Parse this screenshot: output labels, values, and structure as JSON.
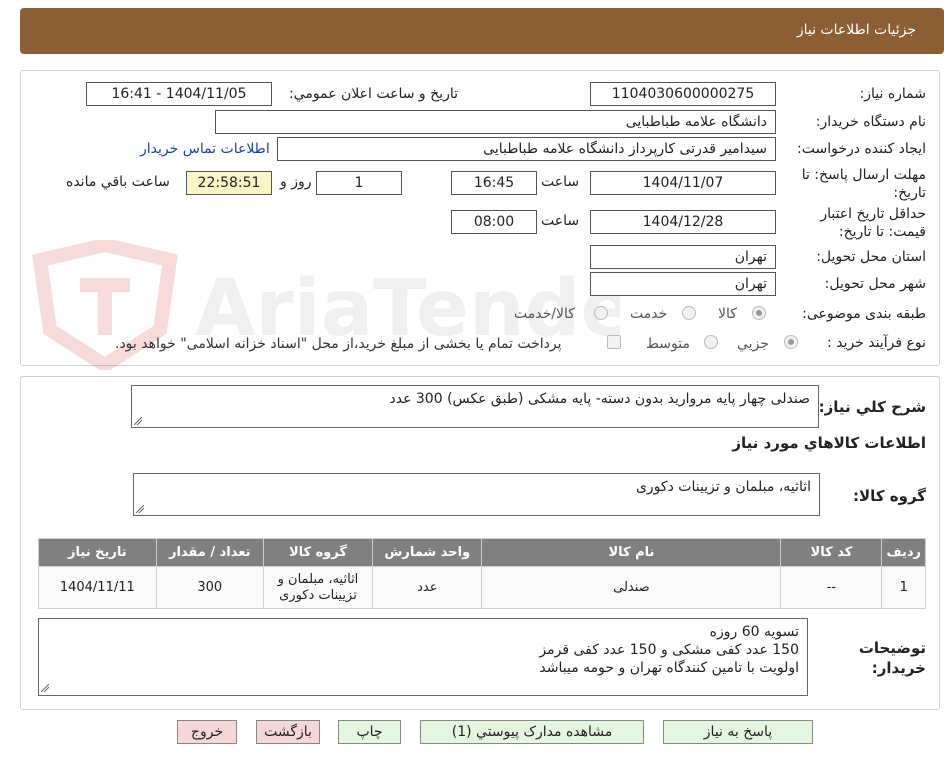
{
  "header": {
    "title": "جزئیات اطلاعات نیاز"
  },
  "form": {
    "need_number_label": "شماره نیاز:",
    "need_number": "1104030600000275",
    "announce_label": "تاریخ و ساعت اعلان عمومي:",
    "announce_value": "1404/11/05 - 16:41",
    "buyer_org_label": "نام دستگاه خریدار:",
    "buyer_org": "دانشگاه علامه طباطبایی",
    "requester_label": "ایجاد کننده درخواست:",
    "requester": "سیدامیر قدرتی کارپرداز دانشگاه علامه طباطبایی",
    "contact_link": "اطلاعات تماس خریدار",
    "deadline_label": "مهلت ارسال پاسخ: تا تاریخ:",
    "deadline_date": "1404/11/07",
    "time_label": "ساعت",
    "deadline_time": "16:45",
    "days_value": "1",
    "days_label": "روز و",
    "remaining_time": "22:58:51",
    "remaining_label": "ساعت باقي مانده",
    "validity_label": "حداقل تاریخ اعتبار قیمت: تا تاریخ:",
    "validity_date": "1404/12/28",
    "validity_time": "08:00",
    "province_label": "استان محل تحویل:",
    "province": "تهران",
    "city_label": "شهر محل تحویل:",
    "city": "تهران",
    "category_label": "طبقه بندی موضوعی:",
    "category_options": [
      "کالا",
      "خدمت",
      "کالا/خدمت"
    ],
    "process_label": "نوع فرآیند خرید :",
    "process_options": [
      "جزیي",
      "متوسط"
    ],
    "payment_note": "پرداخت تمام یا بخشی از مبلغ خرید،از محل \"اسناد خزانه اسلامی\" خواهد بود."
  },
  "summary": {
    "label": "شرح کلي نیاز:",
    "text": "صندلی چهار پایه مروارید بدون دسته- پایه مشکی (طبق عکس) 300 عدد"
  },
  "goods_info": {
    "title": "اطلاعات کالاهاي مورد نیاز",
    "group_label": "گروه کالا:",
    "group_value": "اثاثیه، مبلمان و تزیینات دکوری"
  },
  "table": {
    "headers": [
      "ردیف",
      "کد کالا",
      "نام کالا",
      "واحد شمارش",
      "گروه کالا",
      "تعداد / مقدار",
      "تاریخ نیاز"
    ],
    "rows": [
      [
        "1",
        "--",
        "صندلی",
        "عدد",
        "اثاثیه، مبلمان و تزیینات دکوری",
        "300",
        "1404/11/11"
      ]
    ]
  },
  "buyer_notes": {
    "label": "توضیحات خریدار:",
    "lines": [
      "تسویه 60 روزه",
      "150 عدد کفی مشکی و 150 عدد کفی قرمز",
      "اولویت با تامین کنندگاه تهران و حومه میباشد"
    ]
  },
  "buttons": {
    "reply": "پاسخ به نیاز",
    "attachments": "مشاهده مدارک پیوستي (1)",
    "print": "چاپ",
    "back": "بازگشت",
    "exit": "خروج"
  },
  "watermark": {
    "text": "AriaTender.neT"
  },
  "colors": {
    "header": "#8b5e34",
    "table_header": "#808080",
    "green_button": "#e4f6e0",
    "pink_button": "#f6d7d7",
    "link": "#1a3fb5"
  }
}
